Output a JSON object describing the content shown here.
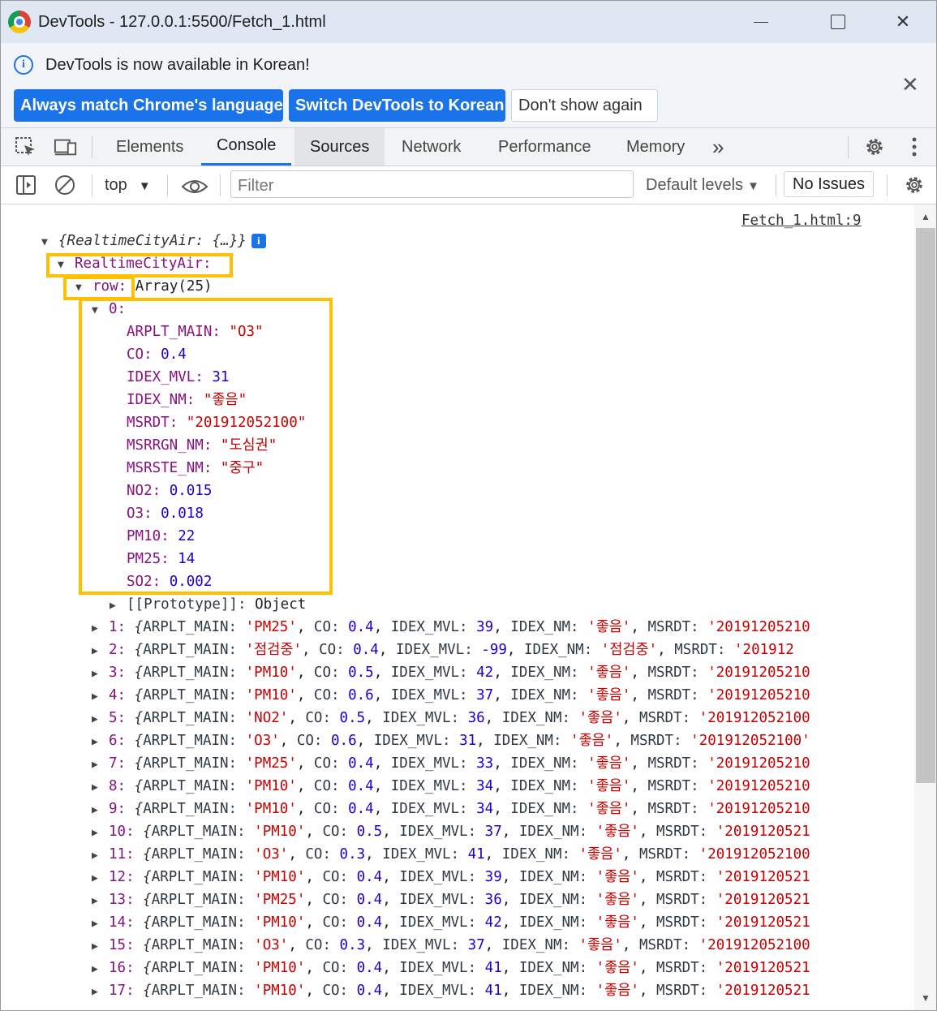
{
  "window": {
    "title": "DevTools - 127.0.0.1:5500/Fetch_1.html"
  },
  "infobar": {
    "message": "DevTools is now available in Korean!",
    "buttons": {
      "always_match": "Always match Chrome's language",
      "switch": "Switch DevTools to Korean",
      "dont_show": "Don't show again"
    }
  },
  "tabs": [
    "Elements",
    "Console",
    "Sources",
    "Network",
    "Performance",
    "Memory"
  ],
  "console_toolbar": {
    "context": "top",
    "filter_placeholder": "Filter",
    "levels": "Default levels",
    "issues": "No Issues"
  },
  "console": {
    "source_link": "Fetch_1.html:9",
    "root_preview": "{RealtimeCityAir: {…}}",
    "root_key": "RealtimeCityAir",
    "row_key": "row",
    "row_value": "Array(25)",
    "item0_index": "0",
    "item0_fields": [
      {
        "key": "ARPLT_MAIN",
        "value": "\"O3\"",
        "type": "str"
      },
      {
        "key": "CO",
        "value": "0.4",
        "type": "num"
      },
      {
        "key": "IDEX_MVL",
        "value": "31",
        "type": "num"
      },
      {
        "key": "IDEX_NM",
        "value": "\"좋음\"",
        "type": "str"
      },
      {
        "key": "MSRDT",
        "value": "\"201912052100\"",
        "type": "str"
      },
      {
        "key": "MSRRGN_NM",
        "value": "\"도심권\"",
        "type": "str"
      },
      {
        "key": "MSRSTE_NM",
        "value": "\"중구\"",
        "type": "str"
      },
      {
        "key": "NO2",
        "value": "0.015",
        "type": "num"
      },
      {
        "key": "O3",
        "value": "0.018",
        "type": "num"
      },
      {
        "key": "PM10",
        "value": "22",
        "type": "num"
      },
      {
        "key": "PM25",
        "value": "14",
        "type": "num"
      },
      {
        "key": "SO2",
        "value": "0.002",
        "type": "num"
      }
    ],
    "prototype_key": "[[Prototype]]",
    "prototype_value": "Object",
    "rows": [
      {
        "i": "1",
        "main": "'PM25'",
        "co": "0.4",
        "mvl": "39",
        "nm": "'좋음'",
        "msrdt": "'20191205210"
      },
      {
        "i": "2",
        "main": "'점검중'",
        "co": "0.4",
        "mvl": "-99",
        "nm": "'점검중'",
        "msrdt": "'201912"
      },
      {
        "i": "3",
        "main": "'PM10'",
        "co": "0.5",
        "mvl": "42",
        "nm": "'좋음'",
        "msrdt": "'20191205210"
      },
      {
        "i": "4",
        "main": "'PM10'",
        "co": "0.6",
        "mvl": "37",
        "nm": "'좋음'",
        "msrdt": "'20191205210"
      },
      {
        "i": "5",
        "main": "'NO2'",
        "co": "0.5",
        "mvl": "36",
        "nm": "'좋음'",
        "msrdt": "'201912052100"
      },
      {
        "i": "6",
        "main": "'O3'",
        "co": "0.6",
        "mvl": "31",
        "nm": "'좋음'",
        "msrdt": "'201912052100'"
      },
      {
        "i": "7",
        "main": "'PM25'",
        "co": "0.4",
        "mvl": "33",
        "nm": "'좋음'",
        "msrdt": "'20191205210"
      },
      {
        "i": "8",
        "main": "'PM10'",
        "co": "0.4",
        "mvl": "34",
        "nm": "'좋음'",
        "msrdt": "'20191205210"
      },
      {
        "i": "9",
        "main": "'PM10'",
        "co": "0.4",
        "mvl": "34",
        "nm": "'좋음'",
        "msrdt": "'20191205210"
      },
      {
        "i": "10",
        "main": "'PM10'",
        "co": "0.5",
        "mvl": "37",
        "nm": "'좋음'",
        "msrdt": "'2019120521"
      },
      {
        "i": "11",
        "main": "'O3'",
        "co": "0.3",
        "mvl": "41",
        "nm": "'좋음'",
        "msrdt": "'201912052100"
      },
      {
        "i": "12",
        "main": "'PM10'",
        "co": "0.4",
        "mvl": "39",
        "nm": "'좋음'",
        "msrdt": "'2019120521"
      },
      {
        "i": "13",
        "main": "'PM25'",
        "co": "0.4",
        "mvl": "36",
        "nm": "'좋음'",
        "msrdt": "'2019120521"
      },
      {
        "i": "14",
        "main": "'PM10'",
        "co": "0.4",
        "mvl": "42",
        "nm": "'좋음'",
        "msrdt": "'2019120521"
      },
      {
        "i": "15",
        "main": "'O3'",
        "co": "0.3",
        "mvl": "37",
        "nm": "'좋음'",
        "msrdt": "'201912052100"
      },
      {
        "i": "16",
        "main": "'PM10'",
        "co": "0.4",
        "mvl": "41",
        "nm": "'좋음'",
        "msrdt": "'2019120521"
      },
      {
        "i": "17",
        "main": "'PM10'",
        "co": "0.4",
        "mvl": "41",
        "nm": "'좋음'",
        "msrdt": "'2019120521"
      }
    ]
  },
  "colors": {
    "highlight": "#ffc000",
    "accent": "#1a73e8",
    "key": "#881280",
    "string": "#c80000",
    "number": "#1c00cf"
  }
}
